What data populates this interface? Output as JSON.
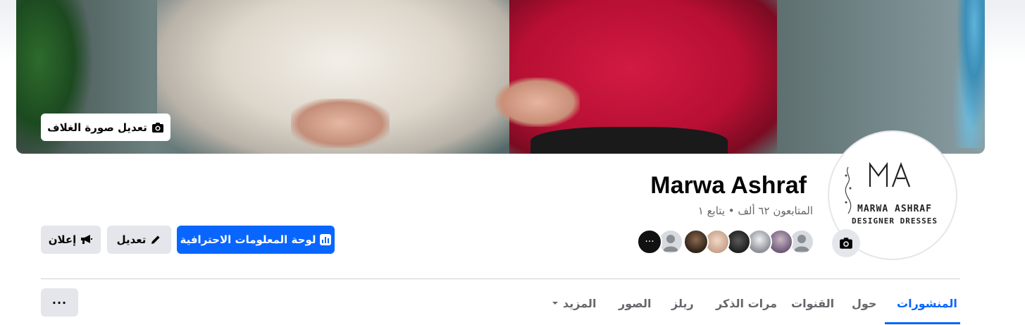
{
  "profile": {
    "name": "Marwa Ashraf",
    "stats": "المتابعون ٦٢ ألف • يتابع ١",
    "logo_line1": "MARWA ASHRAF",
    "logo_line2": "DESIGNER DRESSES"
  },
  "cover": {
    "edit_label": "تعديل صورة الغلاف"
  },
  "actions": {
    "dashboard_label": "لوحة المعلومات الاحترافية",
    "edit_label": "تعديل",
    "ad_label": "إعلان"
  },
  "tabs": [
    {
      "label": "المنشورات",
      "active": true
    },
    {
      "label": "حول"
    },
    {
      "label": "القنوات"
    },
    {
      "label": "مرات الذكر"
    },
    {
      "label": "ريلز"
    },
    {
      "label": "الصور"
    },
    {
      "label": "المزيد"
    }
  ],
  "more_button": "···",
  "friends_more": "···",
  "colors": {
    "accent": "#0866ff",
    "secondary_button": "#e4e6eb",
    "muted_text": "#65676b"
  }
}
